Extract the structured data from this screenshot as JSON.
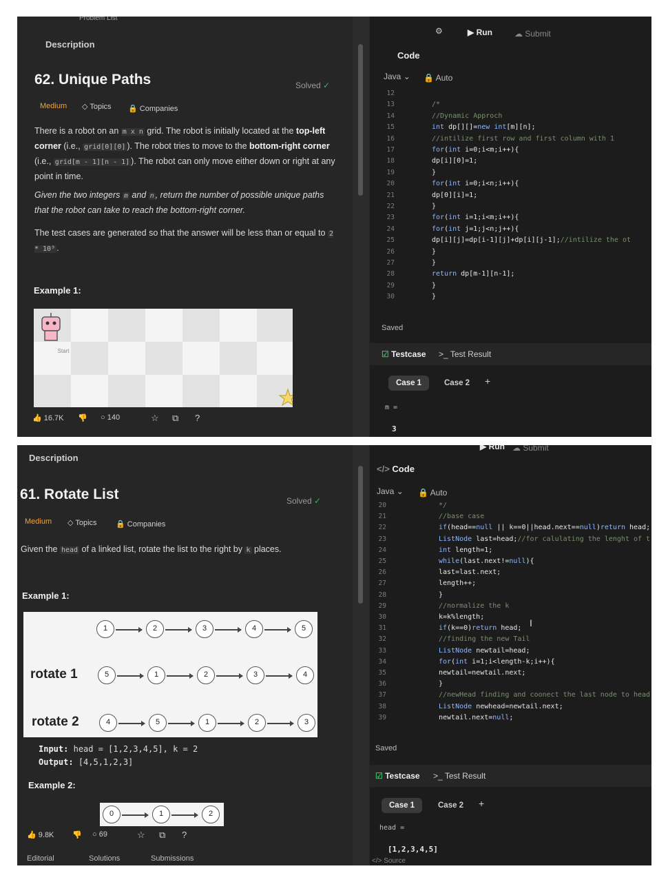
{
  "shot1": {
    "top_label": "Problem List",
    "tab": "Description",
    "title": "62. Unique Paths",
    "solved": "Solved",
    "difficulty": "Medium",
    "topics": "Topics",
    "companies": "Companies",
    "p1_a": "There is a robot on an ",
    "p1_b": "m x n",
    "p1_c": " grid. The robot is initially located at the ",
    "p1_d": "top-left corner",
    "p1_e": " (i.e., ",
    "p1_f": "grid[0][0]",
    "p1_g": "). The robot tries to move to the ",
    "p1_h": "bottom-right corner",
    "p1_i": " (i.e., ",
    "p1_j": "grid[m - 1][n - 1]",
    "p1_k": "). The robot can only move either down or right at any point in time.",
    "p2_a": "Given the two integers ",
    "p2_b": "m",
    "p2_c": " and ",
    "p2_d": "n",
    "p2_e": ", return the number of possible unique paths that the robot can take to reach the bottom-right corner.",
    "p3_a": "The test cases are generated so that the answer will be less than or equal to ",
    "p3_b": "2 * 10⁹",
    "p3_c": ".",
    "example": "Example 1:",
    "start_label": "Start",
    "likes": "16.7K",
    "comments": "140",
    "code_tab": "Code",
    "lang": "Java",
    "auto": "Auto",
    "run": "Run",
    "submit": "Submit",
    "code": [
      {
        "n": "12",
        "t": ""
      },
      {
        "n": "13",
        "t": "/*"
      },
      {
        "n": "14",
        "t": "//Dynamic Approch"
      },
      {
        "n": "15",
        "t": "int dp[][]=new int[m][n];"
      },
      {
        "n": "16",
        "t": "//intilize first row and first column with 1"
      },
      {
        "n": "17",
        "t": "for(int i=0;i<m;i++){"
      },
      {
        "n": "18",
        "t": "    dp[i][0]=1;"
      },
      {
        "n": "19",
        "t": "}"
      },
      {
        "n": "20",
        "t": "for(int i=0;i<n;i++){"
      },
      {
        "n": "21",
        "t": "    dp[0][i]=1;"
      },
      {
        "n": "22",
        "t": "}"
      },
      {
        "n": "23",
        "t": "for(int i=1;i<m;i++){"
      },
      {
        "n": "24",
        "t": "    for(int j=1;j<n;j++){"
      },
      {
        "n": "25",
        "t": "        dp[i][j]=dp[i-1][j]+dp[i][j-1];//intilize the ot"
      },
      {
        "n": "26",
        "t": "    }"
      },
      {
        "n": "27",
        "t": "}"
      },
      {
        "n": "28",
        "t": "return dp[m-1][n-1];"
      },
      {
        "n": "29",
        "t": "}"
      },
      {
        "n": "30",
        "t": "}"
      }
    ],
    "saved": "Saved",
    "testcase": "Testcase",
    "test_result": "Test Result",
    "case1": "Case 1",
    "case2": "Case 2",
    "plus": "+",
    "var_name": "m =",
    "var_value": "3"
  },
  "shot2": {
    "tab": "Description",
    "title": "61. Rotate List",
    "solved": "Solved",
    "difficulty": "Medium",
    "topics": "Topics",
    "companies": "Companies",
    "p1_a": "Given the ",
    "p1_b": "head",
    "p1_c": " of a linked list, rotate the list to the right by ",
    "p1_d": "k",
    "p1_e": " places.",
    "example1": "Example 1:",
    "row0": [
      "1",
      "2",
      "3",
      "4",
      "5"
    ],
    "rotate1_label": "rotate 1",
    "row1": [
      "5",
      "1",
      "2",
      "3",
      "4"
    ],
    "rotate2_label": "rotate 2",
    "row2": [
      "4",
      "5",
      "1",
      "2",
      "3"
    ],
    "input_label": "Input:",
    "input_value": "head = [1,2,3,4,5], k = 2",
    "output_label": "Output:",
    "output_value": "[4,5,1,2,3]",
    "example2": "Example 2:",
    "ex2_nodes": [
      "0",
      "1",
      "2"
    ],
    "likes": "9.8K",
    "comments": "69",
    "footer_tabs": [
      "Editorial",
      "Solutions",
      "Submissions"
    ],
    "code_tab": "Code",
    "lang": "Java",
    "auto": "Auto",
    "run": "Run",
    "submit": "Submit",
    "code": [
      {
        "n": "20",
        "t": "*/"
      },
      {
        "n": "21",
        "t": "//base case"
      },
      {
        "n": "22",
        "t": "if(head==null || k==0||head.next==null)return head;"
      },
      {
        "n": "23",
        "t": "ListNode last=head;//for calulating the lenght of t"
      },
      {
        "n": "24",
        "t": "int length=1;"
      },
      {
        "n": "25",
        "t": "while(last.next!=null){"
      },
      {
        "n": "26",
        "t": "    last=last.next;"
      },
      {
        "n": "27",
        "t": "    length++;"
      },
      {
        "n": "28",
        "t": "}"
      },
      {
        "n": "29",
        "t": "//normalize the k"
      },
      {
        "n": "30",
        "t": "k=k%length;"
      },
      {
        "n": "31",
        "t": "if(k==0)return head;"
      },
      {
        "n": "32",
        "t": "//finding the new Tail"
      },
      {
        "n": "33",
        "t": "ListNode newtail=head;"
      },
      {
        "n": "34",
        "t": "for(int i=1;i<length-k;i++){"
      },
      {
        "n": "35",
        "t": "    newtail=newtail.next;"
      },
      {
        "n": "36",
        "t": "}"
      },
      {
        "n": "37",
        "t": "//newHead finding and coonect the last node to head"
      },
      {
        "n": "38",
        "t": "ListNode newhead=newtail.next;"
      },
      {
        "n": "39",
        "t": "newtail.next=null;"
      }
    ],
    "saved": "Saved",
    "testcase": "Testcase",
    "test_result": "Test Result",
    "case1": "Case 1",
    "case2": "Case 2",
    "plus": "+",
    "var_name": "head =",
    "var_value": "[1,2,3,4,5]",
    "source": "Source"
  }
}
